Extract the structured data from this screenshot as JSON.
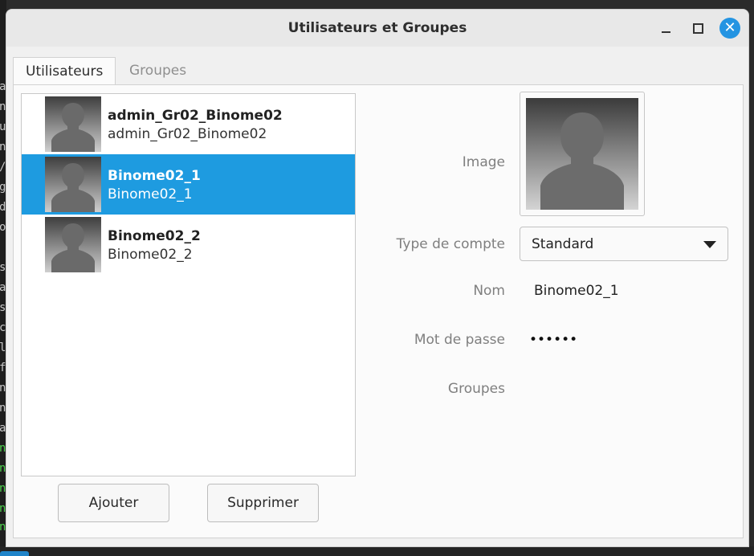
{
  "window": {
    "title": "Utilisateurs et Groupes",
    "close_glyph": "✕"
  },
  "tabs": {
    "users": "Utilisateurs",
    "groups": "Groupes"
  },
  "users": [
    {
      "name": "admin_Gr02_Binome02",
      "login": "admin_Gr02_Binome02",
      "selected": false
    },
    {
      "name": "Binome02_1",
      "login": "Binome02_1",
      "selected": true
    },
    {
      "name": "Binome02_2",
      "login": "Binome02_2",
      "selected": false
    }
  ],
  "buttons": {
    "add": "Ajouter",
    "remove": "Supprimer"
  },
  "details": {
    "image_label": "Image",
    "account_type_label": "Type de compte",
    "account_type_value": "Standard",
    "name_label": "Nom",
    "name_value": "Binome02_1",
    "password_label": "Mot de passe",
    "password_value": "••••••",
    "groups_label": "Groupes"
  },
  "colors": {
    "selection": "#1e9be0",
    "close_button": "#2494e2"
  },
  "icons": {
    "avatar": "user-avatar-icon",
    "dropdown": "chevron-down-icon",
    "close": "close-icon",
    "minimize": "minimize-icon",
    "maximize": "maximize-icon"
  }
}
